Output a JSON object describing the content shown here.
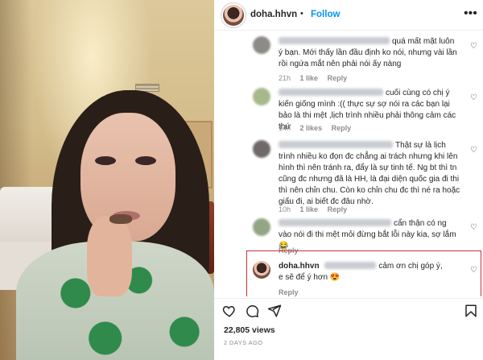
{
  "header": {
    "username": "doha.hhvn",
    "separator": "•",
    "follow_label": "Follow",
    "more_icon": "more-horizontal-icon"
  },
  "comments": [
    {
      "text": "quá mất mặt luôn ý bạn. Mới thấy lần đầu định ko nói, nhưng vài lần rồi ngứa mắt nên phải nói ấy nàng",
      "time": "21h",
      "likes": "1 like",
      "reply": "Reply"
    },
    {
      "text": "cuối cùng có chị ý kiến giống mình :(( thực sự sợ nói ra các bạn lại bảo là thi mệt ,lịch trình nhiều phải thông cảm các thứ",
      "time": "14h",
      "likes": "2 likes",
      "reply": "Reply"
    },
    {
      "text": "Thật sự là lịch trình nhiều ko đọn đc chẳng ai trách nhưng khi lên hình thì nên tránh ra, đẩy là sự tinh tế. Ng bt thì tn cũng đc nhưng đã là HH, là đại diện quốc gia đi thi thì nên chỉn chu. Còn ko chỉn chu đc thì né ra hoặc giấu đi, ai biết đc đâu nhờ.",
      "time": "10h",
      "likes": "1 like",
      "reply": "Reply"
    },
    {
      "text": "cẩn thận có ng vào nói đi thi mệt mỏi đừng bắt lỗi này kia, sợ lắm 😂",
      "time": "",
      "likes": "",
      "reply": "Reply"
    },
    {
      "username": "doha.hhvn",
      "text": "cảm ơn chị góp ý, e sẽ để ý hơn 😍",
      "time": "",
      "likes": "",
      "reply": "Reply"
    }
  ],
  "actions": {
    "icons": [
      "heart-icon",
      "comment-icon",
      "share-icon",
      "bookmark-icon"
    ]
  },
  "stats": {
    "views": "22,805 views",
    "posted": "2 DAYS AGO"
  },
  "colors": {
    "accent": "#0095f6",
    "highlight_border": "#c8303a"
  }
}
